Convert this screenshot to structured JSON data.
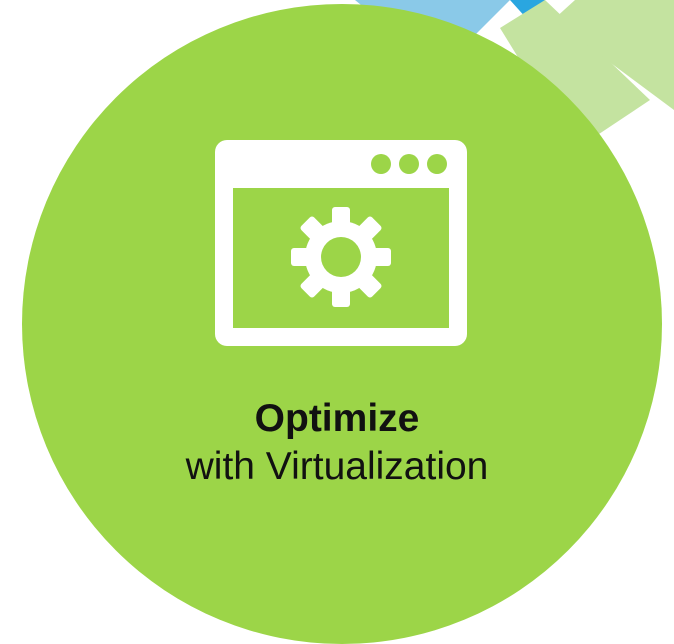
{
  "tile": {
    "title": "Optimize",
    "subtitle": "with Virtualization",
    "icon": "browser-window-gear-icon"
  },
  "colors": {
    "circle": "#9cd548",
    "icon": "#ffffff",
    "text": "#111111",
    "accent_blue": "#8ac9e8",
    "accent_blue_dark": "#2aa6e0",
    "accent_green_light": "#c4e3a0"
  }
}
